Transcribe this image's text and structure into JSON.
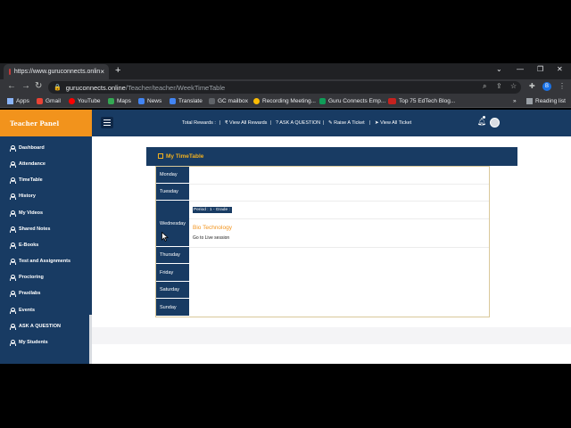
{
  "browser": {
    "tab_title": "https://www.guruconnects.onlin",
    "tab_close": "×",
    "new_tab": "+",
    "url_host": "guruconnects.online",
    "url_path": "/Teacher/teacher/WeekTimeTable",
    "bookmarks": [
      "Apps",
      "Gmail",
      "YouTube",
      "Maps",
      "News",
      "Translate",
      "GC mailbox",
      "Recording Meeting...",
      "Guru Connects Emp...",
      "Top 75 EdTech Blog..."
    ],
    "bookmarks_overflow": "»",
    "reading_list": "Reading list",
    "profile_initial": "B",
    "colors": {
      "frame": "#202124",
      "toolbar": "#35363a",
      "text": "#e8eaed"
    }
  },
  "header": {
    "panel_title": "Teacher Panel",
    "total_rewards": "Total Rewards :",
    "view_all_rewards": "View All Rewards",
    "ask_question": "ASK A QUESTION",
    "raise_ticket": "Raise A Ticket",
    "view_all_ticket": "View All Ticket",
    "separator": "|"
  },
  "sidebar": {
    "items": [
      "Dashboard",
      "Attendance",
      "TimeTable",
      "History",
      "My Videos",
      "Shared Notes",
      "E-Books",
      "Test and Assignments",
      "Proctoring",
      "Praxilabs",
      "Events",
      "ASK A QUESTION",
      "My Students"
    ]
  },
  "timetable": {
    "title": "My TimeTable",
    "days": [
      "Monday",
      "Tuesday",
      "Wednesday",
      "Thursday",
      "Friday",
      "Saturday",
      "Sunday"
    ],
    "entry": {
      "period": "Period : 1 - Grade : ",
      "subject": "Bio Technology",
      "action": "Go to Live session"
    }
  },
  "colors": {
    "navy": "#183b63",
    "orange": "#f2931c",
    "gold": "#f2b01e"
  }
}
